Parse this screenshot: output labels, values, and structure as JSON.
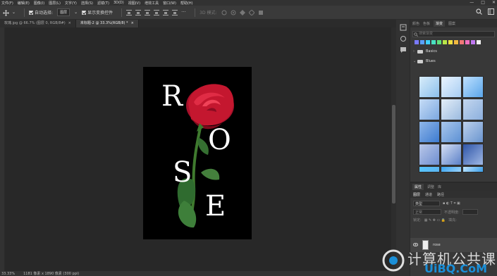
{
  "menubar": {
    "items": [
      "文件(F)",
      "编辑(E)",
      "图像(I)",
      "图层(L)",
      "文字(Y)",
      "选择(S)",
      "滤镜(T)",
      "3D(D)",
      "视图(V)",
      "增效工具",
      "窗口(W)",
      "帮助(H)"
    ],
    "window_controls": [
      "—",
      "□",
      "✕"
    ]
  },
  "options_bar": {
    "auto_select_label": "自动选择:",
    "auto_select_value": "图层",
    "show_transform_label": "显示变换控件",
    "mode_3d_label": "3D 模式:"
  },
  "tabs": [
    {
      "label": "玫瑰.jpg @ 66.7% (图层 0, RGB/8#)",
      "close": "×"
    },
    {
      "label": "未标题-2 @ 33.3%(RGB/8) *",
      "close": "×"
    }
  ],
  "status": {
    "zoom": "33.33%",
    "info": "1181 像素 x 1890 像素 (300 ppi)"
  },
  "canvas": {
    "letters": [
      "R",
      "O",
      "S",
      "E"
    ]
  },
  "panel_top": {
    "tabs": [
      "颜色",
      "色板",
      "渐变",
      "图案"
    ],
    "active_tab": "渐变",
    "search_placeholder": "搜索渐变",
    "folders": [
      {
        "label": "Basics",
        "chevron": "›"
      },
      {
        "label": "Blues",
        "chevron": "⌄"
      }
    ]
  },
  "panel_bottom": {
    "tabs": [
      "属性",
      "调整",
      "库"
    ],
    "sub_tabs": [
      "图层",
      "通道",
      "路径"
    ],
    "kind_label": "类型",
    "blend_mode": "正常",
    "opacity_label": "不透明度:",
    "lock_label": "锁定:",
    "fill_label": "填充:",
    "layer_name": "rose"
  },
  "watermark": {
    "text": "计算机公共课",
    "site": "UiBQ.CoM"
  },
  "colors": {
    "swatches": [
      "#7a7aff",
      "#5aa0ff",
      "#3fd0ff",
      "#48e0c0",
      "#60e07a",
      "#b8e648",
      "#f0e040",
      "#f0b840",
      "#f07878",
      "#f070c0",
      "#c078f0",
      "#f0f0f0"
    ],
    "gradients": [
      [
        "#d8ecfa",
        "#8cc0ec"
      ],
      [
        "#eaf4ff",
        "#a7cdf2"
      ],
      [
        "#bfe0ff",
        "#5aa6ea"
      ],
      [
        "#c6dcf6",
        "#7ca8e0"
      ],
      [
        "#e4eef8",
        "#9bbbe0"
      ],
      [
        "#c3d6ee",
        "#8cb0de"
      ],
      [
        "#8fb6e8",
        "#3d7bd1"
      ],
      [
        "#a9c7ec",
        "#5d91d4"
      ],
      [
        "#bcd0ec",
        "#6a95cf"
      ],
      [
        "#b9c7e8",
        "#6e8ed0"
      ],
      [
        "#d6e0f4",
        "#5b80c8"
      ],
      [
        "#2f55a8",
        "#9fb8e4"
      ],
      [
        "#56c6ff",
        "#5db5ef"
      ],
      [
        "#3aa4f0",
        "#9ad2fb"
      ],
      [
        "#c2e6ff",
        "#3a9ee8"
      ]
    ]
  }
}
